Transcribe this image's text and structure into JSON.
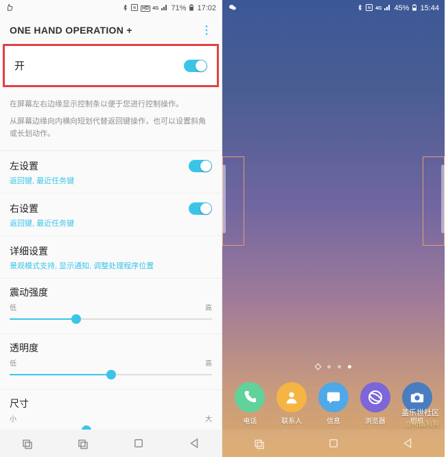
{
  "left": {
    "status": {
      "battery": "71%",
      "time": "17:02"
    },
    "header": {
      "title": "ONE HAND OPERATION +"
    },
    "master": {
      "label": "开",
      "on": true
    },
    "desc_line1": "在屏幕左右边缘显示控制条以便于您进行控制操作。",
    "desc_line2": "从屏幕边缘向内横向短划代替返回键操作，也可以设置斜角或长划动作。",
    "settings": {
      "left": {
        "label": "左设置",
        "sub": "返回键, 最近任务键",
        "on": true
      },
      "right": {
        "label": "右设置",
        "sub": "返回键, 最近任务键",
        "on": true
      },
      "detail": {
        "label": "详细设置",
        "sub": "景观模式支持, 显示通知, 调整处理程序位置"
      }
    },
    "sliders": {
      "vibration": {
        "label": "震动强度",
        "low": "低",
        "high": "高",
        "value": 33
      },
      "transparency": {
        "label": "透明度",
        "low": "低",
        "high": "高",
        "value": 50
      },
      "size": {
        "label": "尺寸",
        "low": "小",
        "high": "大",
        "value": 38
      }
    }
  },
  "right": {
    "status": {
      "battery": "45%",
      "time": "15:44"
    },
    "dock": [
      {
        "label": "电话",
        "color": "#60d29a",
        "icon": "phone"
      },
      {
        "label": "联系人",
        "color": "#f5b544",
        "icon": "contact"
      },
      {
        "label": "信息",
        "color": "#4fa8e8",
        "icon": "message"
      },
      {
        "label": "浏览器",
        "color": "#7c66d9",
        "icon": "browser"
      },
      {
        "label": "相机",
        "color": "#4a7dc0",
        "icon": "camera"
      }
    ],
    "watermark": {
      "title": "盖乐世社区",
      "sub": "@萌面狗狗"
    }
  }
}
